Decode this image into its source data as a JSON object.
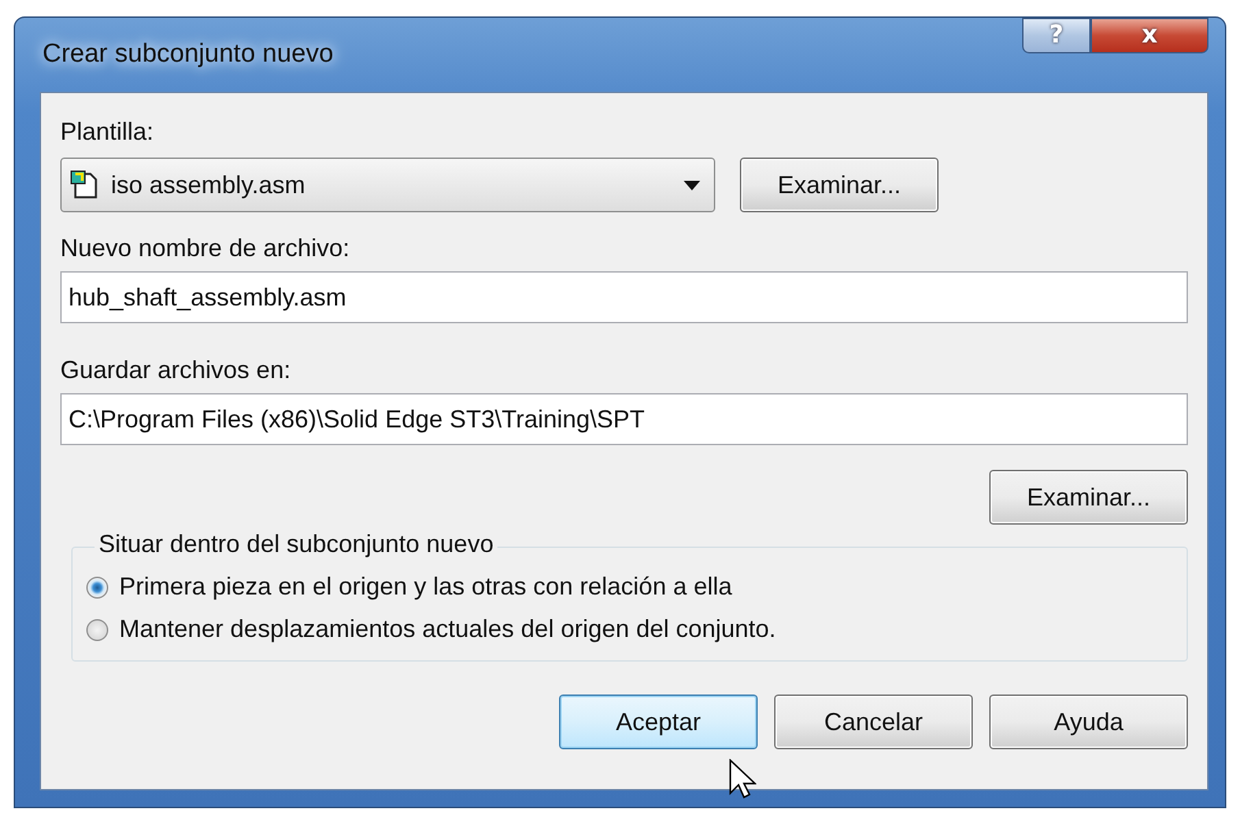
{
  "window": {
    "title": "Crear subconjunto nuevo",
    "help_glyph": "?",
    "close_glyph": "x"
  },
  "template": {
    "label": "Plantilla:",
    "value": "iso assembly.asm",
    "browse": "Examinar..."
  },
  "filename": {
    "label": "Nuevo nombre de archivo:",
    "value": "hub_shaft_assembly.asm"
  },
  "save_in": {
    "label": "Guardar archivos en:",
    "value": "C:\\Program Files (x86)\\Solid Edge ST3\\Training\\SPT",
    "browse": "Examinar..."
  },
  "placement": {
    "title": "Situar dentro del subconjunto nuevo",
    "options": [
      {
        "label": "Primera pieza en el origen y las otras con relación a ella",
        "selected": true
      },
      {
        "label": "Mantener desplazamientos actuales del origen del conjunto.",
        "selected": false
      }
    ]
  },
  "buttons": [
    {
      "label": "Aceptar",
      "focused": true
    },
    {
      "label": "Cancelar",
      "focused": false
    },
    {
      "label": "Ayuda",
      "focused": false
    }
  ]
}
